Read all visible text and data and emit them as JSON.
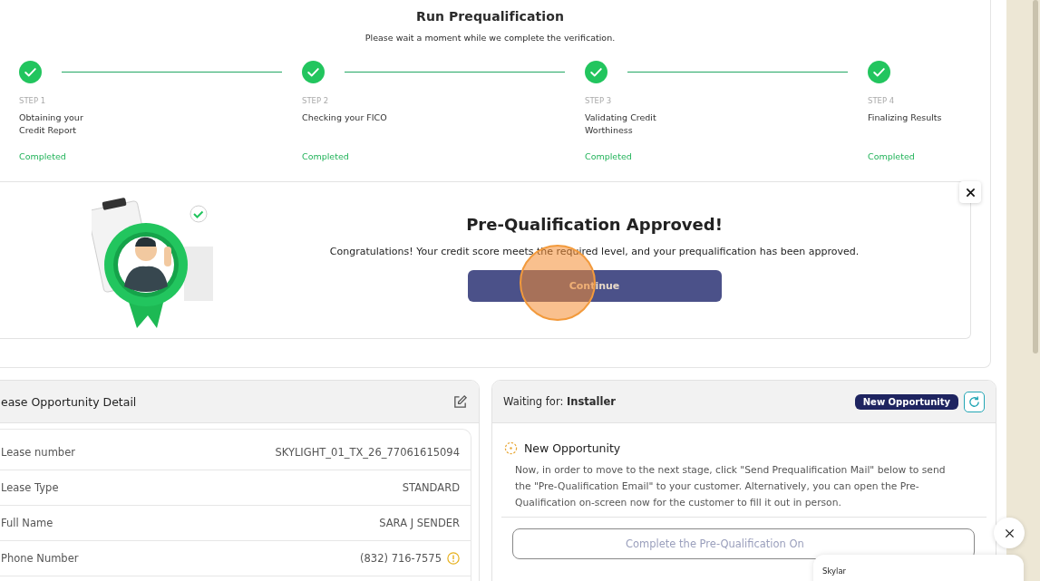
{
  "header": {
    "title": "Run Prequalification",
    "subtitle": "Please wait a moment while we complete the verification."
  },
  "steps": [
    {
      "step": "STEP 1",
      "name": "Obtaining your\nCredit Report",
      "status": "Completed",
      "done": true
    },
    {
      "step": "STEP 2",
      "name": "Checking your FICO",
      "status": "Completed",
      "done": true
    },
    {
      "step": "STEP 3",
      "name": "Validating Credit\nWorthiness",
      "status": "Completed",
      "done": true
    },
    {
      "step": "STEP 4",
      "name": "Finalizing Results",
      "status": "Completed",
      "done": true
    }
  ],
  "approval": {
    "title": "Pre-Qualification Approved!",
    "message": "Congratulations! Your credit score meets the required level, and your prequalification has been approved.",
    "button": "Continue"
  },
  "lease_detail": {
    "title": "ease Opportunity Detail",
    "rows": [
      {
        "label": "Lease number",
        "value": "SKYLIGHT_01_TX_26_77061615094",
        "warning": false
      },
      {
        "label": "Lease Type",
        "value": "STANDARD",
        "warning": false
      },
      {
        "label": "Full Name",
        "value": "SARA J SENDER",
        "warning": false
      },
      {
        "label": "Phone Number",
        "value": "(832) 716-7575",
        "warning": true
      }
    ]
  },
  "status_panel": {
    "waiting": "Waiting for: **Installer**",
    "badge": "New Opportunity",
    "stage": "New Opportunity",
    "description": "Now, in order to move to the next stage, click \"Send Prequalification Mail\" below to send the \"Pre-Qualification Email\" to your customer. Alternatively, you can open the Pre-Qualification on-screen now for the customer to fill it out in person.",
    "action": "Complete the Pre-Qualification On"
  },
  "chat": {
    "name": "Skylar"
  }
}
